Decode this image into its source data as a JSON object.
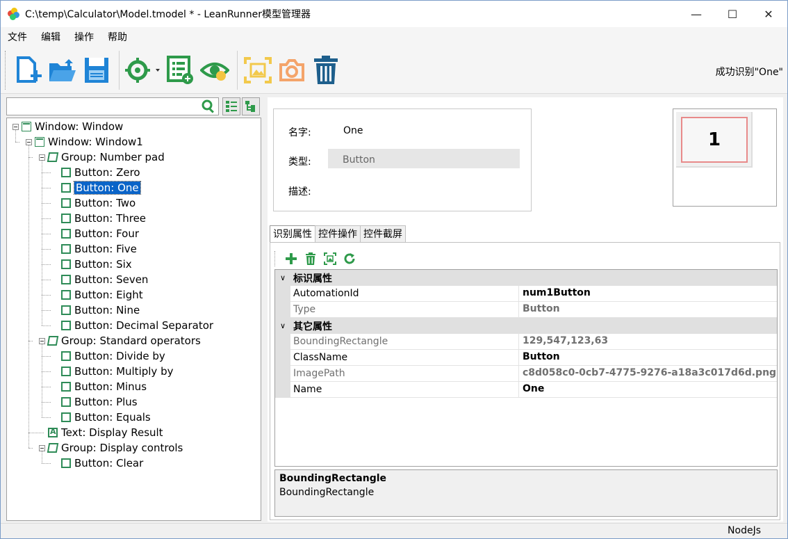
{
  "window": {
    "title": "C:\\temp\\Calculator\\Model.tmodel * - LeanRunner模型管理器",
    "minimize": "—",
    "maximize": "☐",
    "close": "✕"
  },
  "menu": [
    "文件",
    "编辑",
    "操作",
    "帮助"
  ],
  "toolbar": {
    "buttons": [
      "new-model-icon",
      "open-folder-icon",
      "save-icon",
      "target-capture-icon",
      "add-list-icon",
      "eye-highlight-icon",
      "screenshot-frame-icon",
      "camera-icon",
      "trash-icon"
    ],
    "status": "成功识别\"One\""
  },
  "search": {
    "value": "",
    "placeholder": ""
  },
  "tree": [
    {
      "label": "Window: Window",
      "kind": "win",
      "level": 0,
      "expander": true
    },
    {
      "label": "Window: Window1",
      "kind": "win",
      "level": 1,
      "expander": true
    },
    {
      "label": "Group: Number pad",
      "kind": "group",
      "level": 2,
      "expander": true
    },
    {
      "label": "Button: Zero",
      "kind": "button",
      "level": 3
    },
    {
      "label": "Button: One",
      "kind": "button",
      "level": 3,
      "selected": true
    },
    {
      "label": "Button: Two",
      "kind": "button",
      "level": 3
    },
    {
      "label": "Button: Three",
      "kind": "button",
      "level": 3
    },
    {
      "label": "Button: Four",
      "kind": "button",
      "level": 3
    },
    {
      "label": "Button: Five",
      "kind": "button",
      "level": 3
    },
    {
      "label": "Button: Six",
      "kind": "button",
      "level": 3
    },
    {
      "label": "Button: Seven",
      "kind": "button",
      "level": 3
    },
    {
      "label": "Button: Eight",
      "kind": "button",
      "level": 3
    },
    {
      "label": "Button: Nine",
      "kind": "button",
      "level": 3
    },
    {
      "label": "Button: Decimal Separator",
      "kind": "button",
      "level": 3
    },
    {
      "label": "Group: Standard operators",
      "kind": "group",
      "level": 2,
      "expander": true
    },
    {
      "label": "Button: Divide by",
      "kind": "button",
      "level": 3
    },
    {
      "label": "Button: Multiply by",
      "kind": "button",
      "level": 3
    },
    {
      "label": "Button: Minus",
      "kind": "button",
      "level": 3
    },
    {
      "label": "Button: Plus",
      "kind": "button",
      "level": 3
    },
    {
      "label": "Button: Equals",
      "kind": "button",
      "level": 3
    },
    {
      "label": "Text: Display Result",
      "kind": "text",
      "level": 2
    },
    {
      "label": "Group: Display controls",
      "kind": "group",
      "level": 2,
      "expander": true
    },
    {
      "label": "Button: Clear",
      "kind": "button",
      "level": 3
    }
  ],
  "info": {
    "name_label": "名字:",
    "name_value": "One",
    "type_label": "类型:",
    "type_value": "Button",
    "desc_label": "描述:"
  },
  "thumbnail": {
    "text": "1"
  },
  "tabs": [
    "识别属性",
    "控件操作",
    "控件截屏"
  ],
  "properties": {
    "categories": [
      {
        "title": "标识属性",
        "rows": [
          {
            "name": "AutomationId",
            "value": "num1Button",
            "readonly": false
          },
          {
            "name": "Type",
            "value": "Button",
            "readonly": true
          }
        ]
      },
      {
        "title": "其它属性",
        "rows": [
          {
            "name": "BoundingRectangle",
            "value": "129,547,123,63",
            "readonly": true
          },
          {
            "name": "ClassName",
            "value": "Button",
            "readonly": false
          },
          {
            "name": "ImagePath",
            "value": "c8d058c0-0cb7-4775-9276-a18a3c017d6d.png",
            "readonly": true
          },
          {
            "name": "Name",
            "value": "One",
            "readonly": false
          }
        ]
      }
    ]
  },
  "description": {
    "title": "BoundingRectangle",
    "text": "BoundingRectangle"
  },
  "statusbar": {
    "right": "NodeJs"
  }
}
